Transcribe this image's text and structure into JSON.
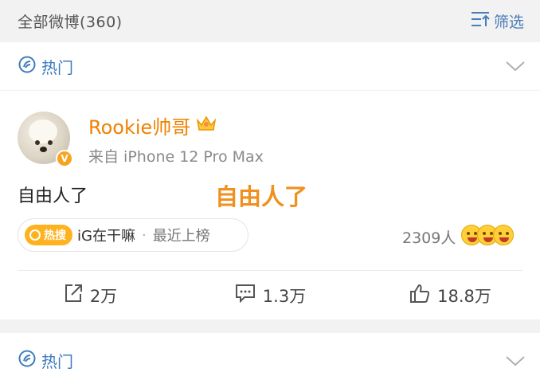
{
  "filter_bar": {
    "count_label": "全部微博(360)",
    "filter_label": "筛选"
  },
  "section": {
    "hot_label": "热门"
  },
  "post": {
    "username": "Rookie帅哥",
    "source": "来自 iPhone 12 Pro Max",
    "text": "自由人了",
    "overlay_text": "自由人了",
    "hot_tag": "热搜",
    "topic": "iG在干嘛",
    "topic_separator": "·",
    "topic_suffix": "最近上榜",
    "people_count": "2309人",
    "reposts": "2万",
    "comments": "1.3万",
    "likes": "18.8万"
  },
  "section2": {
    "hot_label": "热门"
  },
  "colors": {
    "accent_blue": "#3d7bbf",
    "username_orange": "#f08200",
    "hot_tag": "#ffb21f"
  },
  "icons": [
    "filter-icon",
    "hot-icon",
    "chevron-down-icon",
    "crown-icon",
    "verified-icon",
    "repost-icon",
    "comment-icon",
    "like-icon"
  ]
}
